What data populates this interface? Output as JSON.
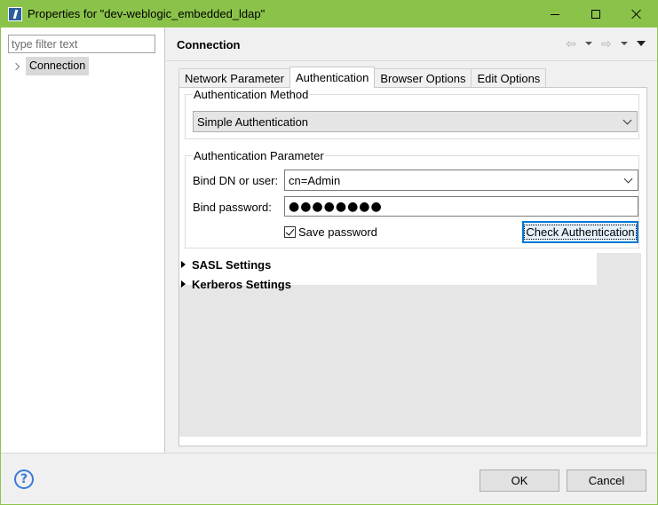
{
  "window": {
    "title": "Properties for \"dev-weblogic_embedded_ldap\""
  },
  "left_pane": {
    "filter_placeholder": "type filter text",
    "tree_items": [
      {
        "label": "Connection",
        "selected": true
      }
    ]
  },
  "page": {
    "title": "Connection"
  },
  "tabs": [
    {
      "label": "Network Parameter",
      "active": false
    },
    {
      "label": "Authentication",
      "active": true
    },
    {
      "label": "Browser Options",
      "active": false
    },
    {
      "label": "Edit Options",
      "active": false
    }
  ],
  "authentication_method": {
    "legend": "Authentication Method",
    "selected": "Simple Authentication"
  },
  "authentication_parameter": {
    "legend": "Authentication Parameter",
    "bind_dn_label": "Bind DN or user:",
    "bind_dn_value": "cn=Admin",
    "bind_password_label": "Bind password:",
    "bind_password_masked": "●●●●●●●●",
    "save_password_label": "Save password",
    "save_password_checked": true,
    "check_auth_button": "Check Authentication"
  },
  "sections": {
    "sasl": "SASL Settings",
    "kerberos": "Kerberos Settings"
  },
  "footer": {
    "help_glyph": "?",
    "ok": "OK",
    "cancel": "Cancel"
  },
  "colors": {
    "titlebar": "#8bc34a",
    "focus_border": "#0078d7"
  }
}
